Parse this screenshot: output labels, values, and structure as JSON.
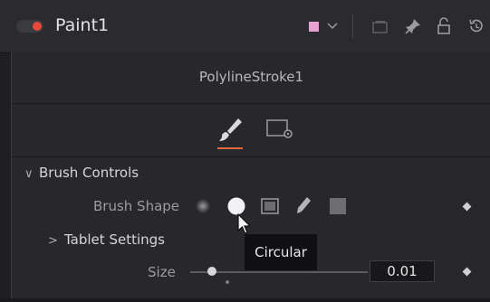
{
  "header": {
    "node_name": "Paint1",
    "icons": [
      "enable-toggle",
      "color-swatch",
      "chevron-down-icon",
      "versions-icon",
      "pin-icon",
      "lock-icon",
      "reset-icon"
    ],
    "colors": {
      "toggle_dot": "#e64a3c",
      "swatch": "#e6a2d2"
    }
  },
  "panel": {
    "subtitle": "PolylineStroke1",
    "tabs": [
      {
        "name": "brush-controls-tab",
        "icon": "paintbrush-icon",
        "active": true
      },
      {
        "name": "settings-tab",
        "icon": "settings-icon",
        "active": false
      }
    ],
    "accent": "#e5683a"
  },
  "brush_controls": {
    "section_label": "Brush Controls",
    "brush_shape_label": "Brush Shape",
    "brush_shapes": [
      "soft-brush",
      "circular",
      "image",
      "single-pixel",
      "square"
    ],
    "selected_shape": "circular",
    "tablet_settings_label": "Tablet Settings",
    "size_label": "Size",
    "size_value": "0.01"
  },
  "tooltip": {
    "text": "Circular"
  }
}
